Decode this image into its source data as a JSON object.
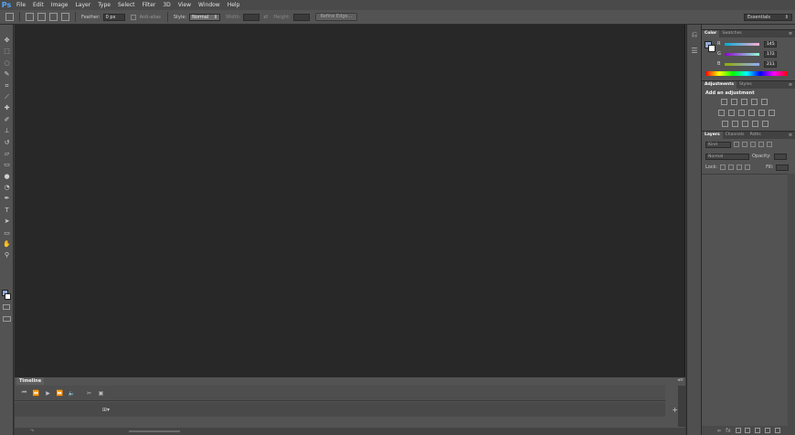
{
  "app": {
    "logo_text": "Ps"
  },
  "menu": [
    "File",
    "Edit",
    "Image",
    "Layer",
    "Type",
    "Select",
    "Filter",
    "3D",
    "View",
    "Window",
    "Help"
  ],
  "options_bar": {
    "feather_label": "Feather:",
    "feather_value": "0 px",
    "antialias_label": "Anti-alias",
    "style_label": "Style:",
    "style_value": "Normal",
    "width_label": "Width:",
    "height_label": "Height:",
    "refine_edge_label": "Refine Edge..."
  },
  "workspace": {
    "selected": "Essentials"
  },
  "toolbar": {
    "tools": [
      {
        "name": "move-tool",
        "glyph": "✥"
      },
      {
        "name": "marquee-tool",
        "glyph": "⬚"
      },
      {
        "name": "lasso-tool",
        "glyph": "◌"
      },
      {
        "name": "quick-select-tool",
        "glyph": "✎"
      },
      {
        "name": "crop-tool",
        "glyph": "⌗"
      },
      {
        "name": "eyedropper-tool",
        "glyph": "⟋"
      },
      {
        "name": "healing-brush-tool",
        "glyph": "✚"
      },
      {
        "name": "brush-tool",
        "glyph": "✐"
      },
      {
        "name": "clone-stamp-tool",
        "glyph": "⊥"
      },
      {
        "name": "history-brush-tool",
        "glyph": "↺"
      },
      {
        "name": "eraser-tool",
        "glyph": "▱"
      },
      {
        "name": "gradient-tool",
        "glyph": "▭"
      },
      {
        "name": "blur-tool",
        "glyph": "●"
      },
      {
        "name": "dodge-tool",
        "glyph": "◔"
      },
      {
        "name": "pen-tool",
        "glyph": "✒"
      },
      {
        "name": "type-tool",
        "glyph": "T"
      },
      {
        "name": "path-selection-tool",
        "glyph": "➤"
      },
      {
        "name": "rectangle-tool",
        "glyph": "▭"
      },
      {
        "name": "hand-tool",
        "glyph": "✋"
      },
      {
        "name": "zoom-tool",
        "glyph": "⚲"
      }
    ],
    "foreground_color": "#91acd3",
    "background_color": "#ffffff"
  },
  "timeline": {
    "tab_label": "Timeline",
    "controls": [
      "⏮",
      "⏪",
      "▶",
      "⏩",
      "🔈",
      "✂",
      "▣"
    ]
  },
  "color_panel": {
    "tabs": [
      "Color",
      "Swatches"
    ],
    "r_label": "R",
    "r_value": "145",
    "g_label": "G",
    "g_value": "172",
    "b_label": "B",
    "b_value": "211"
  },
  "adjustments_panel": {
    "tabs": [
      "Adjustments",
      "Styles"
    ],
    "title": "Add an adjustment"
  },
  "layers_panel": {
    "tabs": [
      "Layers",
      "Channels",
      "Paths"
    ],
    "kind_label": "Kind",
    "blend_mode": "Normal",
    "opacity_label": "Opacity:",
    "lock_label": "Lock:",
    "fill_label": "Fill:"
  }
}
